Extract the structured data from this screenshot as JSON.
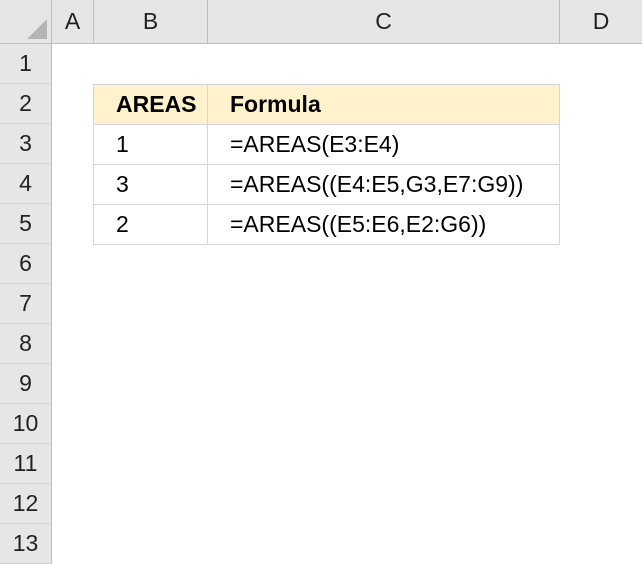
{
  "columns": [
    "A",
    "B",
    "C",
    "D"
  ],
  "rows": [
    "1",
    "2",
    "3",
    "4",
    "5",
    "6",
    "7",
    "8",
    "9",
    "10",
    "11",
    "12",
    "13"
  ],
  "table": {
    "header": {
      "areas": "AREAS",
      "formula": "Formula"
    },
    "rows": [
      {
        "areas": "1",
        "formula": "=AREAS(E3:E4)"
      },
      {
        "areas": "3",
        "formula": "=AREAS((E4:E5,G3,E7:G9))"
      },
      {
        "areas": "2",
        "formula": "=AREAS((E5:E6,E2:G6))"
      }
    ],
    "header_fill": "#fff2cc"
  }
}
